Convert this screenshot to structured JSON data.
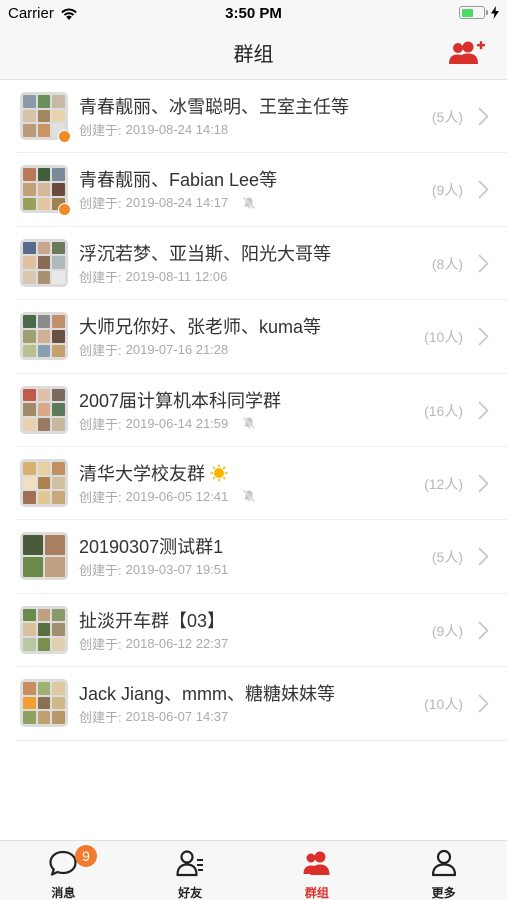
{
  "status_bar": {
    "carrier": "Carrier",
    "time": "3:50 PM",
    "battery_level": 0.55
  },
  "nav": {
    "title": "群组",
    "add_icon": "add-group-icon"
  },
  "groups": [
    {
      "name": "青春靓丽、冰雪聪明、王室主任等",
      "created_label": "创建于:",
      "date": "2019-08-24 14:18",
      "count": "(5人)",
      "muted": false,
      "owner": true,
      "tiles": [
        "#8a9aa6",
        "#6b8f5a",
        "#c7b9a5",
        "#d6c4a8",
        "#a3875e",
        "#e8d4b0",
        "#b99a7a",
        "#c89664",
        "#e0e0e0"
      ]
    },
    {
      "name": "青春靓丽、Fabian Lee等",
      "created_label": "创建于:",
      "date": "2019-08-24 14:17",
      "count": "(9人)",
      "muted": true,
      "owner": true,
      "tiles": [
        "#b87a5a",
        "#3f5e3a",
        "#7a8a9a",
        "#c2a07a",
        "#d8b89a",
        "#6a4a3a",
        "#9aa05a",
        "#e2c6a0",
        "#a08050"
      ]
    },
    {
      "name": "浮沉若梦、亚当斯、阳光大哥等",
      "created_label": "创建于:",
      "date": "2019-08-11 12:06",
      "count": "(8人)",
      "muted": false,
      "owner": false,
      "tiles": [
        "#5a6a8a",
        "#c8a890",
        "#6a7a5a",
        "#e0c0a0",
        "#8a6a50",
        "#b0b8c0",
        "#d8c8b0",
        "#a89070",
        "#e8e8e8"
      ]
    },
    {
      "name": "大师兄你好、张老师、kuma等",
      "created_label": "创建于:",
      "date": "2019-07-16 21:28",
      "count": "(10人)",
      "muted": false,
      "owner": false,
      "tiles": [
        "#4a6a4a",
        "#8a8a8a",
        "#c0906a",
        "#a0a070",
        "#d0b090",
        "#6a5040",
        "#b8c090",
        "#8aa0b0",
        "#c8a070"
      ]
    },
    {
      "name": "2007届计算机本科同学群",
      "created_label": "创建于:",
      "date": "2019-06-14 21:59",
      "count": "(16人)",
      "muted": true,
      "owner": false,
      "tiles": [
        "#c05a4a",
        "#e0c0a8",
        "#7a6a5a",
        "#a08a6a",
        "#d8a888",
        "#5a7a5a",
        "#e8d0b0",
        "#9a7a60",
        "#c8b8a0"
      ]
    },
    {
      "name": "清华大学校友群",
      "created_label": "创建于:",
      "date": "2019-06-05 12:41",
      "count": "(12人)",
      "muted": true,
      "owner": false,
      "emoji": true,
      "tiles": [
        "#d8b070",
        "#e8d0a0",
        "#c09060",
        "#f0e0c0",
        "#b08050",
        "#d0c0a0",
        "#a07050",
        "#e0c890",
        "#c8a878"
      ]
    },
    {
      "name": "20190307测试群1",
      "created_label": "创建于:",
      "date": "2019-03-07 19:51",
      "count": "(5人)",
      "muted": false,
      "owner": false,
      "grid": 2,
      "tiles": [
        "#4a5a3a",
        "#a88060",
        "#6a8a4a",
        "#c0a080"
      ]
    },
    {
      "name": "扯淡开车群【03】",
      "created_label": "创建于:",
      "date": "2018-06-12 22:37",
      "count": "(9人)",
      "muted": false,
      "owner": false,
      "tiles": [
        "#6a8a4a",
        "#c0a080",
        "#8a9a6a",
        "#d8c0a0",
        "#5a7040",
        "#a09070",
        "#b8c8a0",
        "#7a9050",
        "#e0d0b0"
      ]
    },
    {
      "name": "Jack Jiang、mmm、糖糖妹妹等",
      "created_label": "创建于:",
      "date": "2018-06-07 14:37",
      "count": "(10人)",
      "muted": false,
      "owner": false,
      "tiles": [
        "#c89060",
        "#a0b070",
        "#e0c8a0",
        "#f0a030",
        "#8a7050",
        "#d0b888",
        "#90a060",
        "#c0a070",
        "#b89868"
      ]
    }
  ],
  "tabs": [
    {
      "label": "消息",
      "icon": "chat-bubble-icon",
      "badge": "9",
      "active": false
    },
    {
      "label": "好友",
      "icon": "contacts-icon",
      "active": false
    },
    {
      "label": "群组",
      "icon": "group-icon",
      "active": true
    },
    {
      "label": "更多",
      "icon": "person-icon",
      "active": false
    }
  ],
  "colors": {
    "accent": "#d9302c",
    "badge": "#f07a2e",
    "owner_badge": "#f08a24",
    "muted_text": "#aaaaaa"
  }
}
